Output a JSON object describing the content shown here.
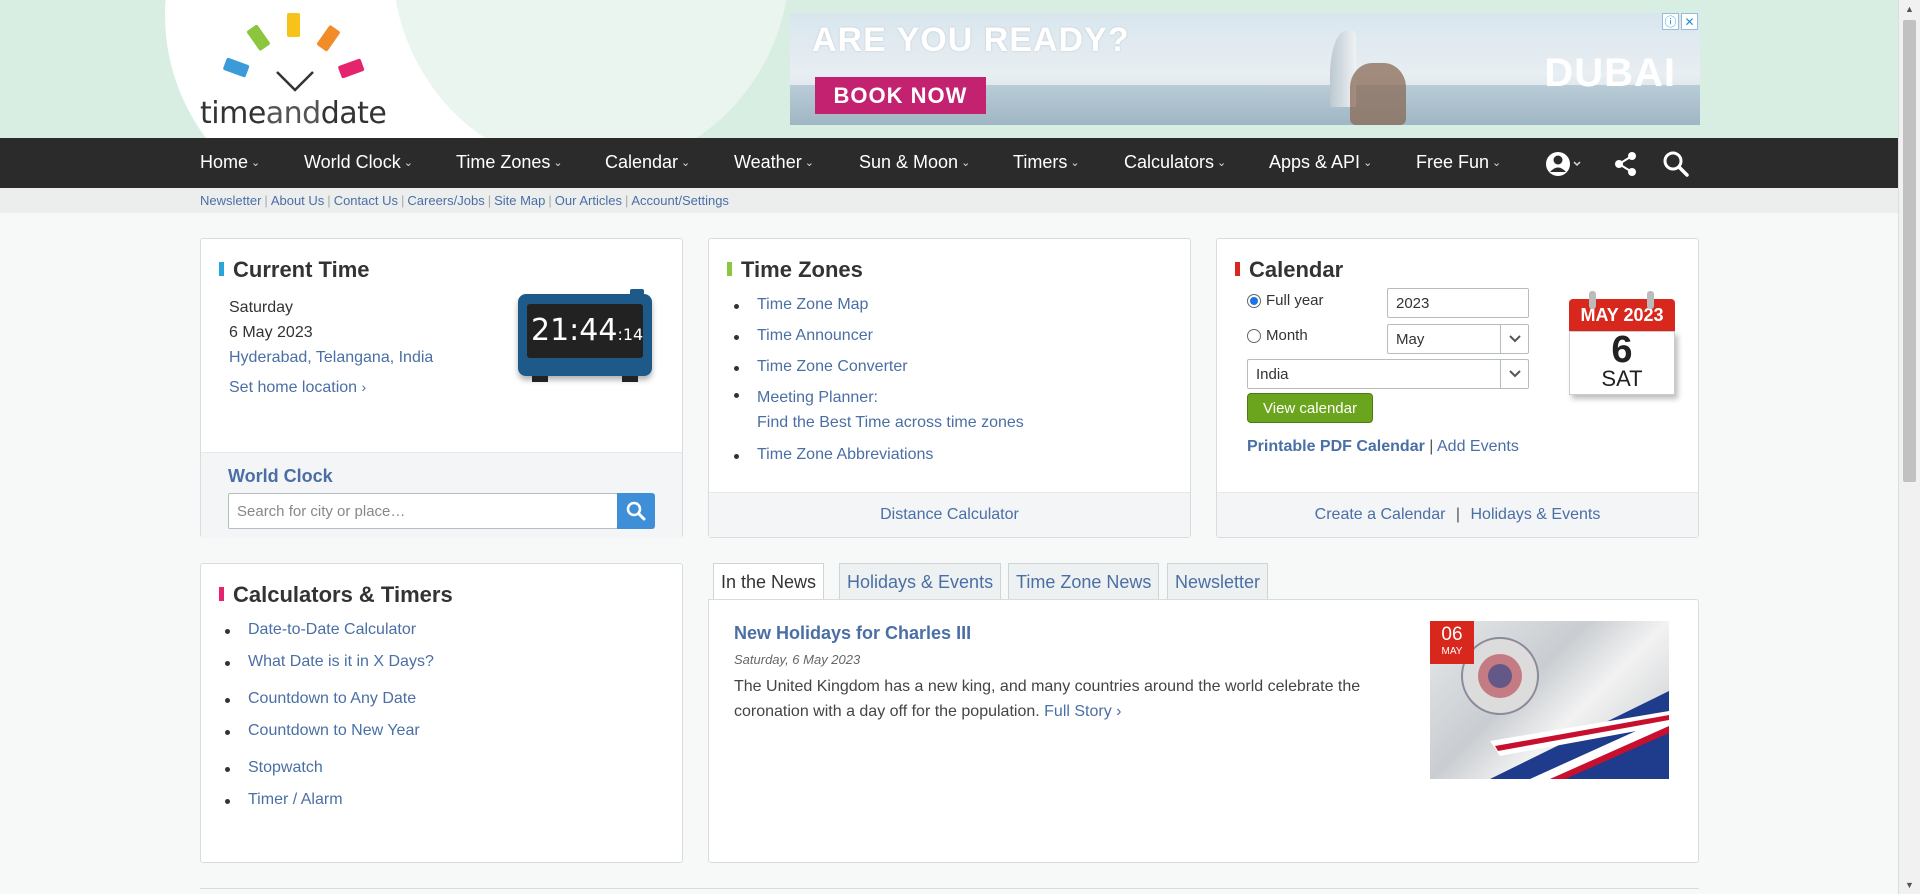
{
  "logo": {
    "brand_left": "time",
    "brand_mid": "and",
    "brand_right": "date"
  },
  "ad": {
    "headline": "ARE YOU READY?",
    "cta": "BOOK NOW",
    "brand": "DUBAI"
  },
  "nav": {
    "items": [
      "Home",
      "World Clock",
      "Time Zones",
      "Calendar",
      "Weather",
      "Sun & Moon",
      "Timers",
      "Calculators",
      "Apps & API",
      "Free Fun"
    ]
  },
  "subnav": [
    "Newsletter",
    "About Us",
    "Contact Us",
    "Careers/Jobs",
    "Site Map",
    "Our Articles",
    "Account/Settings"
  ],
  "current_time": {
    "title": "Current Time",
    "day": "Saturday",
    "date": "6 May 2023",
    "location": "Hyderabad, Telangana, India",
    "set_home": "Set home location",
    "clock_main": "21:44",
    "clock_sec": ":14",
    "world_clock": "World Clock",
    "search_placeholder": "Search for city or place…"
  },
  "time_zones": {
    "title": "Time Zones",
    "links": [
      "Time Zone Map",
      "Time Announcer",
      "Time Zone Converter",
      "Meeting Planner:",
      "Time Zone Abbreviations"
    ],
    "meeting_sub": "Find the Best Time across time zones",
    "footer": "Distance Calculator"
  },
  "calendar": {
    "title": "Calendar",
    "full_year": "Full year",
    "month": "Month",
    "year_value": "2023",
    "month_value": "May",
    "country_value": "India",
    "view_btn": "View calendar",
    "printable": "Printable PDF Calendar",
    "separator": "|",
    "add_events": "Add Events",
    "footer_create": "Create a Calendar",
    "footer_holidays": "Holidays & Events",
    "icon_month": "MAY 2023",
    "icon_day": "6",
    "icon_weekday": "SAT"
  },
  "calculators": {
    "title": "Calculators & Timers",
    "links": [
      "Date-to-Date Calculator",
      "What Date is it in X Days?",
      "Countdown to Any Date",
      "Countdown to New Year",
      "Stopwatch",
      "Timer / Alarm"
    ]
  },
  "news": {
    "tabs": [
      "In the News",
      "Holidays & Events",
      "Time Zone News",
      "Newsletter"
    ],
    "title": "New Holidays for Charles III",
    "date": "Saturday, 6 May 2023",
    "text": "The United Kingdom has a new king, and many countries around the world celebrate the coronation with a day off for the population.",
    "full_story": "Full Story",
    "badge_day": "06",
    "badge_month": "MAY"
  },
  "colors": {
    "nav_bg": "#2b2b2b",
    "link": "#4a6fa5",
    "green": "#6aa51d",
    "red": "#d8271d"
  }
}
